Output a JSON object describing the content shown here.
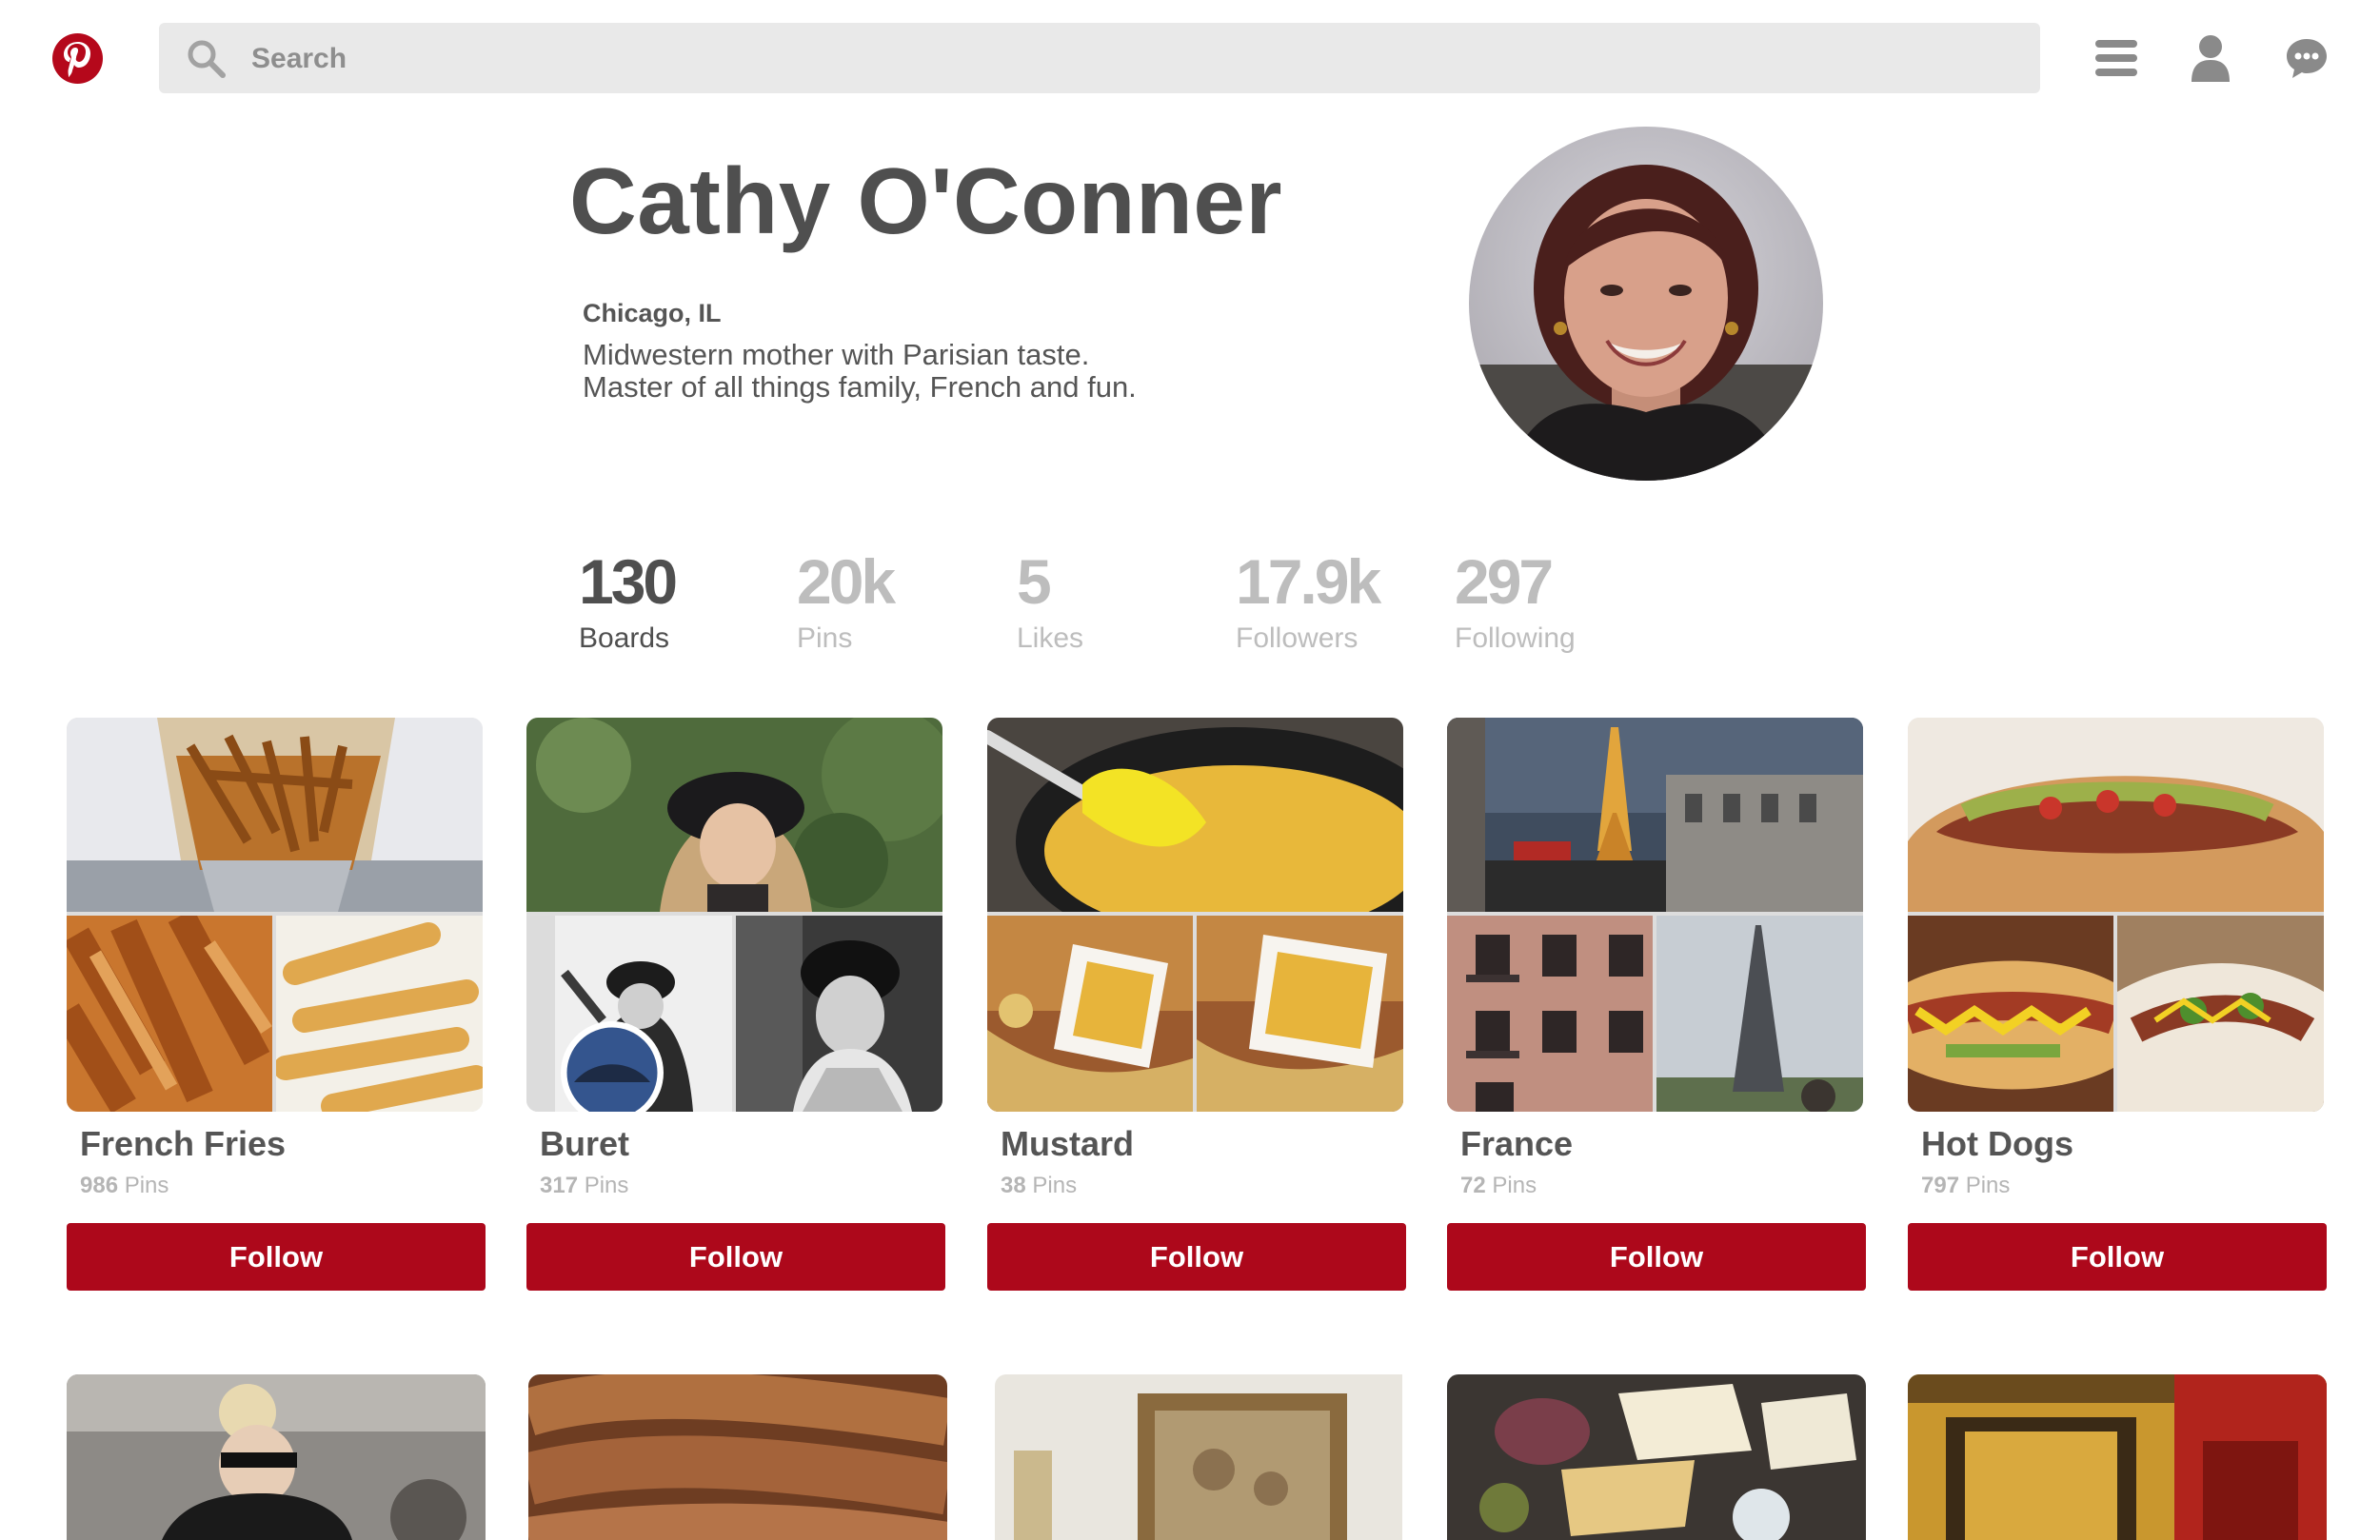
{
  "header": {
    "logo_icon": "pinterest-logo-icon",
    "search_placeholder": "Search",
    "search_value": "",
    "icons": [
      "search-icon",
      "menu-icon",
      "user-icon",
      "chat-icon"
    ]
  },
  "profile": {
    "name": "Cathy O'Conner",
    "location": "Chicago, IL",
    "bio_line1": "Midwestern mother with Parisian taste.",
    "bio_line2": "Master of all things family, French and fun."
  },
  "stats": [
    {
      "value": "130",
      "label": "Boards"
    },
    {
      "value": "20k",
      "label": "Pins"
    },
    {
      "value": "5",
      "label": "Likes"
    },
    {
      "value": "17.9k",
      "label": "Followers"
    },
    {
      "value": "297",
      "label": "Following"
    }
  ],
  "boards": [
    {
      "title": "French Fries",
      "pins_count": "986",
      "pins_word": "Pins",
      "follow_label": "Follow"
    },
    {
      "title": "Buret",
      "pins_count": "317",
      "pins_word": "Pins",
      "follow_label": "Follow"
    },
    {
      "title": "Mustard",
      "pins_count": "38",
      "pins_word": "Pins",
      "follow_label": "Follow"
    },
    {
      "title": "France",
      "pins_count": "72",
      "pins_word": "Pins",
      "follow_label": "Follow"
    },
    {
      "title": "Hot Dogs",
      "pins_count": "797",
      "pins_word": "Pins",
      "follow_label": "Follow"
    }
  ],
  "colors": {
    "brand_red": "#ad081b",
    "text_dark": "#4f4f4f",
    "text_muted": "#bdbdbd",
    "search_bg": "#e9e9e9"
  }
}
